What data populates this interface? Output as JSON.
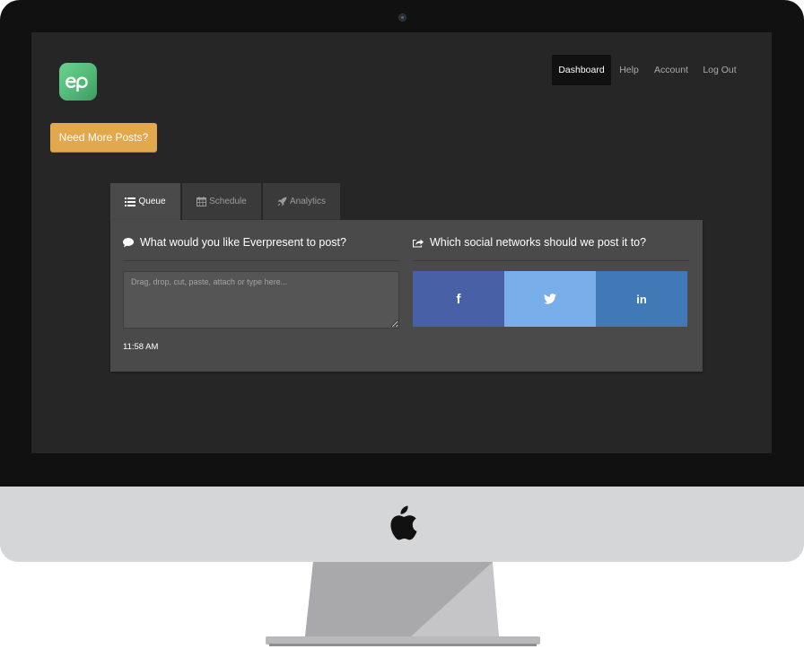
{
  "nav": {
    "items": [
      {
        "label": "Dashboard",
        "active": true
      },
      {
        "label": "Help",
        "active": false
      },
      {
        "label": "Account",
        "active": false
      },
      {
        "label": "Log Out",
        "active": false
      }
    ]
  },
  "cta": {
    "label": "Need More Posts?",
    "color": "#e2a84e"
  },
  "tabs": [
    {
      "label": "Queue",
      "icon": "list-icon",
      "active": true
    },
    {
      "label": "Schedule",
      "icon": "calendar-icon",
      "active": false
    },
    {
      "label": "Analytics",
      "icon": "rocket-icon",
      "active": false
    }
  ],
  "compose": {
    "heading": "What would you like Everpresent to post?",
    "placeholder": "Drag, drop, cut, paste, attach or type here...",
    "time": "11:58 AM"
  },
  "networks": {
    "heading": "Which social networks should we post it to?",
    "items": [
      {
        "name": "facebook",
        "glyph": "f",
        "color": "#4860a6"
      },
      {
        "name": "twitter",
        "glyph": "twitter-bird-icon",
        "color": "#78aeea"
      },
      {
        "name": "linkedin",
        "glyph": "in",
        "color": "#4178b6"
      }
    ]
  },
  "colors": {
    "screen_bg": "#262626",
    "panel_bg": "#4a4a4a",
    "brand_green": "#52b978"
  }
}
